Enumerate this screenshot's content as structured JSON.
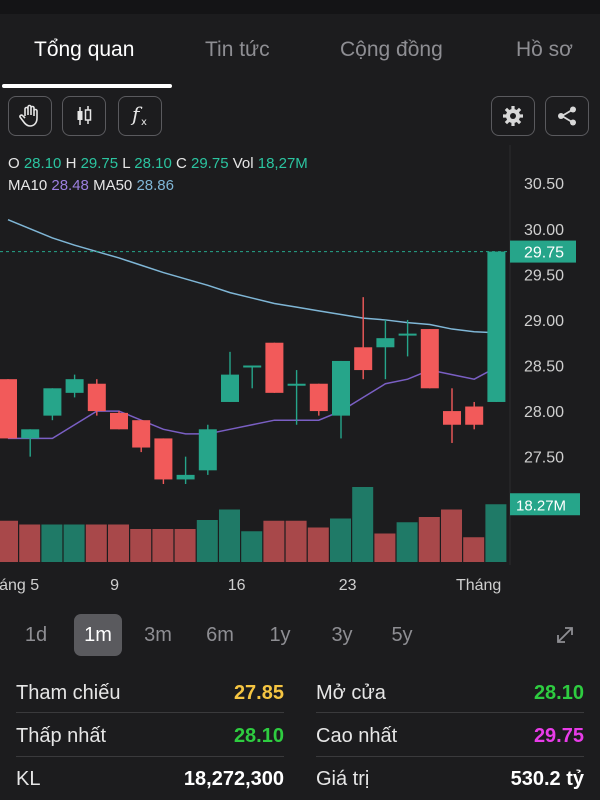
{
  "tabs": [
    {
      "label": "Tổng quan",
      "active": true
    },
    {
      "label": "Tin tức",
      "active": false
    },
    {
      "label": "Cộng đồng",
      "active": false
    },
    {
      "label": "Hồ sơ",
      "active": false
    }
  ],
  "toolbar": {
    "left_icons": [
      "hand-icon",
      "candlestick-icon",
      "function-icon"
    ],
    "right_icons": [
      "gear-icon",
      "share-icon"
    ]
  },
  "ohlc": {
    "o_label": "O",
    "o": "28.10",
    "h_label": "H",
    "h": "29.75",
    "l_label": "L",
    "l": "28.10",
    "c_label": "C",
    "c": "29.75",
    "vol_label": "Vol",
    "vol": "18,27M"
  },
  "ma": {
    "ma10_label": "MA10",
    "ma10": "28.48",
    "ma50_label": "MA50",
    "ma50": "28.86"
  },
  "chart_data": {
    "type": "candlestick",
    "y_axis_ticks": [
      "30.50",
      "30.00",
      "29.50",
      "29.00",
      "28.50",
      "28.00",
      "27.50",
      "27.00"
    ],
    "ylim": [
      26.75,
      30.7
    ],
    "x_labels": [
      "áng 5",
      "9",
      "16",
      "23",
      "Tháng"
    ],
    "x_label_index": [
      -0.4,
      4.8,
      10.3,
      15.3,
      21.2
    ],
    "last_price_label": "29.75",
    "last_volume_label": "18.27M",
    "last_price": 29.75,
    "candles": [
      {
        "o": 28.35,
        "h": 28.35,
        "l": 27.7,
        "c": 27.7
      },
      {
        "o": 27.7,
        "h": 27.8,
        "l": 27.5,
        "c": 27.8
      },
      {
        "o": 27.95,
        "h": 28.25,
        "l": 27.9,
        "c": 28.25
      },
      {
        "o": 28.2,
        "h": 28.4,
        "l": 28.15,
        "c": 28.35
      },
      {
        "o": 28.3,
        "h": 28.35,
        "l": 27.95,
        "c": 28.0
      },
      {
        "o": 27.98,
        "h": 28.0,
        "l": 27.8,
        "c": 27.8
      },
      {
        "o": 27.9,
        "h": 27.9,
        "l": 27.55,
        "c": 27.6
      },
      {
        "o": 27.7,
        "h": 27.7,
        "l": 27.2,
        "c": 27.25
      },
      {
        "o": 27.25,
        "h": 27.5,
        "l": 27.2,
        "c": 27.3
      },
      {
        "o": 27.35,
        "h": 27.85,
        "l": 27.3,
        "c": 27.8
      },
      {
        "o": 28.1,
        "h": 28.65,
        "l": 28.1,
        "c": 28.4
      },
      {
        "o": 28.5,
        "h": 28.5,
        "l": 28.25,
        "c": 28.5
      },
      {
        "o": 28.75,
        "h": 28.75,
        "l": 28.2,
        "c": 28.2
      },
      {
        "o": 28.3,
        "h": 28.45,
        "l": 27.85,
        "c": 28.3
      },
      {
        "o": 28.3,
        "h": 28.3,
        "l": 27.95,
        "c": 28.0
      },
      {
        "o": 27.95,
        "h": 28.55,
        "l": 27.7,
        "c": 28.55
      },
      {
        "o": 28.7,
        "h": 29.25,
        "l": 28.35,
        "c": 28.45
      },
      {
        "o": 28.7,
        "h": 29.0,
        "l": 28.35,
        "c": 28.8
      },
      {
        "o": 28.85,
        "h": 29.0,
        "l": 28.6,
        "c": 28.85
      },
      {
        "o": 28.9,
        "h": 28.9,
        "l": 28.25,
        "c": 28.25
      },
      {
        "o": 28.0,
        "h": 28.25,
        "l": 27.65,
        "c": 27.85
      },
      {
        "o": 28.05,
        "h": 28.1,
        "l": 27.8,
        "c": 27.85
      },
      {
        "o": 28.1,
        "h": 29.75,
        "l": 28.1,
        "c": 29.75
      }
    ],
    "volume": [
      {
        "v": 0.55,
        "up": false
      },
      {
        "v": 0.5,
        "up": false
      },
      {
        "v": 0.5,
        "up": true
      },
      {
        "v": 0.5,
        "up": true
      },
      {
        "v": 0.5,
        "up": false
      },
      {
        "v": 0.5,
        "up": false
      },
      {
        "v": 0.44,
        "up": false
      },
      {
        "v": 0.44,
        "up": false
      },
      {
        "v": 0.44,
        "up": false
      },
      {
        "v": 0.56,
        "up": true
      },
      {
        "v": 0.7,
        "up": true
      },
      {
        "v": 0.41,
        "up": true
      },
      {
        "v": 0.55,
        "up": false
      },
      {
        "v": 0.55,
        "up": false
      },
      {
        "v": 0.46,
        "up": false
      },
      {
        "v": 0.58,
        "up": true
      },
      {
        "v": 1.0,
        "up": true
      },
      {
        "v": 0.38,
        "up": false
      },
      {
        "v": 0.53,
        "up": true
      },
      {
        "v": 0.6,
        "up": false
      },
      {
        "v": 0.7,
        "up": false
      },
      {
        "v": 0.33,
        "up": false
      },
      {
        "v": 0.77,
        "up": true
      }
    ],
    "ma10": [
      27.7,
      27.7,
      27.7,
      27.85,
      28.0,
      28.0,
      27.9,
      27.8,
      27.75,
      27.75,
      27.8,
      27.85,
      27.9,
      27.9,
      27.9,
      28.0,
      28.15,
      28.3,
      28.35,
      28.45,
      28.4,
      28.35,
      28.48
    ],
    "ma50": [
      30.1,
      30.0,
      29.9,
      29.82,
      29.75,
      29.68,
      29.6,
      29.52,
      29.45,
      29.38,
      29.3,
      29.24,
      29.18,
      29.14,
      29.1,
      29.06,
      29.02,
      29.0,
      28.97,
      28.95,
      28.9,
      28.87,
      28.86
    ],
    "colors": {
      "up": "#26a58a",
      "down": "#f25a5a",
      "vol_up": "#1f7a67",
      "vol_down": "#a8484a",
      "ma10": "#7a5fc4",
      "ma50": "#7fb6d6",
      "price_tag": "#26a58a"
    }
  },
  "ranges": [
    {
      "label": "1d",
      "active": false
    },
    {
      "label": "1m",
      "active": true
    },
    {
      "label": "3m",
      "active": false
    },
    {
      "label": "6m",
      "active": false
    },
    {
      "label": "1y",
      "active": false
    },
    {
      "label": "3y",
      "active": false
    },
    {
      "label": "5y",
      "active": false
    }
  ],
  "stats": {
    "ref_label": "Tham chiếu",
    "ref_value": "27.85",
    "ref_color": "#f5c542",
    "open_label": "Mở cửa",
    "open_value": "28.10",
    "open_color": "#2ecc40",
    "low_label": "Thấp nhất",
    "low_value": "28.10",
    "low_color": "#2ecc40",
    "high_label": "Cao nhất",
    "high_value": "29.75",
    "high_color": "#e83ce8",
    "vol_label": "KL",
    "vol_value": "18,272,300",
    "vol_color": "#ffffff",
    "value_label": "Giá trị",
    "value_value": "530.2 tỷ",
    "value_color": "#ffffff"
  }
}
